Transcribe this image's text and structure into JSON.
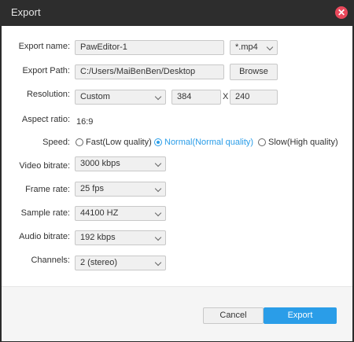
{
  "window": {
    "title": "Export",
    "close_symbol": "✕"
  },
  "labels": {
    "export_name": "Export name:",
    "export_path": "Export Path:",
    "resolution": "Resolution:",
    "aspect_ratio": "Aspect ratio:",
    "speed": "Speed:",
    "video_bitrate": "Video bitrate:",
    "frame_rate": "Frame rate:",
    "sample_rate": "Sample rate:",
    "audio_bitrate": "Audio bitrate:",
    "channels": "Channels:"
  },
  "fields": {
    "export_name": "PawEditor-1",
    "format": "*.mp4",
    "export_path": "C:/Users/MaiBenBen/Desktop",
    "browse_label": "Browse",
    "resolution": "Custom",
    "width": "384",
    "by": "X",
    "height": "240",
    "aspect_ratio": "16:9",
    "video_bitrate": "3000 kbps",
    "frame_rate": "25 fps",
    "sample_rate": "44100 HZ",
    "audio_bitrate": "192 kbps",
    "channels": "2 (stereo)"
  },
  "speed_options": [
    {
      "label": "Fast(Low quality)",
      "selected": false
    },
    {
      "label": "Normal(Normal quality)",
      "selected": true
    },
    {
      "label": "Slow(High quality)",
      "selected": false
    }
  ],
  "footer": {
    "cancel_label": "Cancel",
    "export_label": "Export"
  },
  "colors": {
    "accent": "#2a9de8",
    "close": "#e9485b",
    "titlebar": "#2d2d2d"
  }
}
